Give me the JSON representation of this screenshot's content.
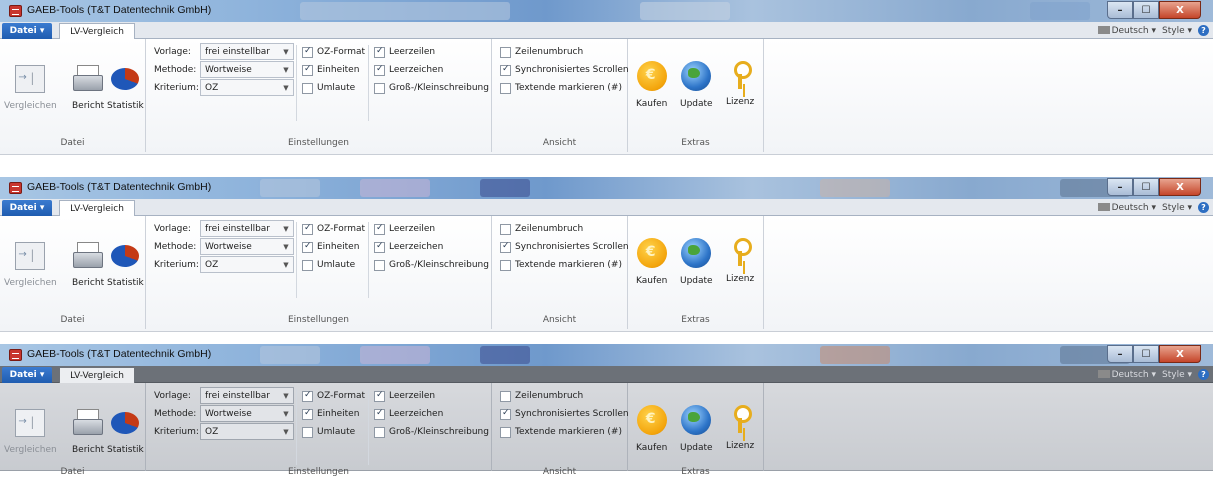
{
  "windows": [
    {
      "title": "GAEB-Tools (T&T Datentechnik GmbH)",
      "menu": {
        "file": "Datei ▾",
        "tab": "LV-Vergleich"
      },
      "right_tools": {
        "language": "Deutsch ▾",
        "style": "Style ▾",
        "help": "?"
      },
      "controls": {
        "minimize": "–",
        "maximize": "☐",
        "close": "X"
      },
      "groups": {
        "datei": {
          "label": "Datei",
          "compare": "Vergleichen",
          "report": "Bericht",
          "stats": "Statistik"
        },
        "einstellungen": {
          "label": "Einstellungen",
          "vorlage_label": "Vorlage:",
          "vorlage_value": "frei einstellbar",
          "methode_label": "Methode:",
          "methode_value": "Wortweise",
          "kriterium_label": "Kriterium:",
          "kriterium_value": "OZ",
          "oz_format": "OZ-Format",
          "einheiten": "Einheiten",
          "umlaute": "Umlaute",
          "leerzeilen": "Leerzeilen",
          "leerzeichen": "Leerzeichen",
          "gross_klein": "Groß-/Kleinschreibung"
        },
        "ansicht": {
          "label": "Ansicht",
          "zeilenumbruch": "Zeilenumbruch",
          "sync_scroll": "Synchronisiertes Scrollen",
          "textende": "Textende markieren (#)"
        },
        "extras": {
          "label": "Extras",
          "buy": "Kaufen",
          "update": "Update",
          "license": "Lizenz"
        }
      }
    },
    {
      "title": "GAEB-Tools (T&T Datentechnik GmbH)",
      "menu": {
        "file": "Datei ▾",
        "tab": "LV-Vergleich"
      },
      "right_tools": {
        "language": "Deutsch ▾",
        "style": "Style ▾",
        "help": "?"
      },
      "controls": {
        "minimize": "–",
        "maximize": "☐",
        "close": "X"
      },
      "groups": {
        "datei": {
          "label": "Datei",
          "compare": "Vergleichen",
          "report": "Bericht",
          "stats": "Statistik"
        },
        "einstellungen": {
          "label": "Einstellungen",
          "vorlage_label": "Vorlage:",
          "vorlage_value": "frei einstellbar",
          "methode_label": "Methode:",
          "methode_value": "Wortweise",
          "kriterium_label": "Kriterium:",
          "kriterium_value": "OZ",
          "oz_format": "OZ-Format",
          "einheiten": "Einheiten",
          "umlaute": "Umlaute",
          "leerzeilen": "Leerzeilen",
          "leerzeichen": "Leerzeichen",
          "gross_klein": "Groß-/Kleinschreibung"
        },
        "ansicht": {
          "label": "Ansicht",
          "zeilenumbruch": "Zeilenumbruch",
          "sync_scroll": "Synchronisiertes Scrollen",
          "textende": "Textende markieren (#)"
        },
        "extras": {
          "label": "Extras",
          "buy": "Kaufen",
          "update": "Update",
          "license": "Lizenz"
        }
      }
    },
    {
      "title": "GAEB-Tools (T&T Datentechnik GmbH)",
      "menu": {
        "file": "Datei ▾",
        "tab": "LV-Vergleich"
      },
      "right_tools": {
        "language": "Deutsch ▾",
        "style": "Style ▾",
        "help": "?"
      },
      "controls": {
        "minimize": "–",
        "maximize": "☐",
        "close": "X"
      },
      "groups": {
        "datei": {
          "label": "Datei",
          "compare": "Vergleichen",
          "report": "Bericht",
          "stats": "Statistik"
        },
        "einstellungen": {
          "label": "Einstellungen",
          "vorlage_label": "Vorlage:",
          "vorlage_value": "frei einstellbar",
          "methode_label": "Methode:",
          "methode_value": "Wortweise",
          "kriterium_label": "Kriterium:",
          "kriterium_value": "OZ",
          "oz_format": "OZ-Format",
          "einheiten": "Einheiten",
          "umlaute": "Umlaute",
          "leerzeilen": "Leerzeilen",
          "leerzeichen": "Leerzeichen",
          "gross_klein": "Groß-/Kleinschreibung"
        },
        "ansicht": {
          "label": "Ansicht",
          "zeilenumbruch": "Zeilenumbruch",
          "sync_scroll": "Synchronisiertes Scrollen",
          "textende": "Textende markieren (#)"
        },
        "extras": {
          "label": "Extras",
          "buy": "Kaufen",
          "update": "Update",
          "license": "Lizenz"
        }
      }
    }
  ]
}
